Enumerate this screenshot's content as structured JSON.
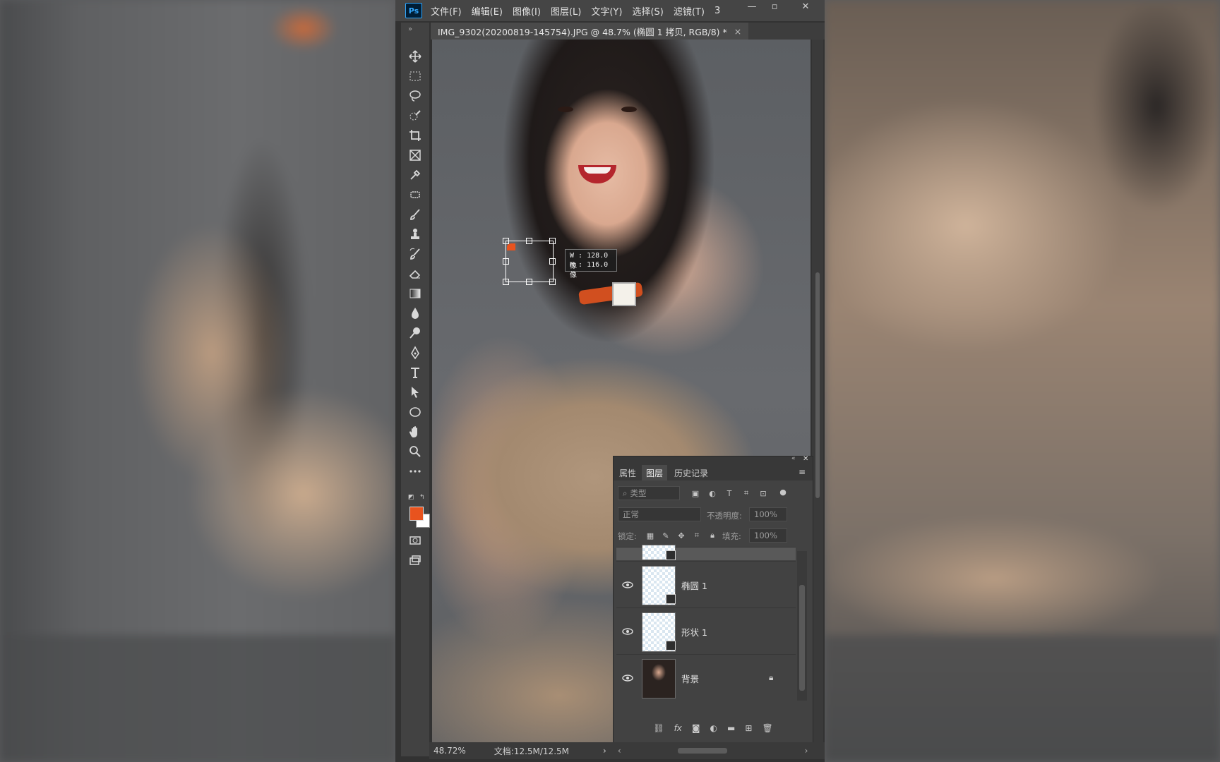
{
  "app": {
    "logo": "Ps"
  },
  "menu": [
    "文件(F)",
    "编辑(E)",
    "图像(I)",
    "图层(L)",
    "文字(Y)",
    "选择(S)",
    "滤镜(T)",
    "3"
  ],
  "window_controls": {
    "minimize": "—",
    "restore": "▫",
    "close": "✕"
  },
  "document_tab": {
    "title": "IMG_9302(20200819-145754).JPG @ 48.7% (椭圆 1 拷贝, RGB/8) *",
    "close": "×"
  },
  "tools": [
    "move-tool",
    "marquee-tool",
    "lasso-tool",
    "quick-select-tool",
    "crop-tool",
    "frame-tool",
    "eyedropper-tool",
    "healing-brush-tool",
    "brush-tool",
    "clone-stamp-tool",
    "history-brush-tool",
    "eraser-tool",
    "gradient-tool",
    "blur-tool",
    "dodge-tool",
    "pen-tool",
    "type-tool",
    "path-selection-tool",
    "ellipse-tool",
    "hand-tool",
    "zoom-tool",
    "edit-toolbar"
  ],
  "colors": {
    "foreground": "#e8531e",
    "background": "#ffffff"
  },
  "transform_readout": {
    "w": "W : 128.0 像",
    "h": "H : 116.0 像"
  },
  "status": {
    "zoom": "48.72%",
    "doc": "文档:12.5M/12.5M",
    "arrow": "›"
  },
  "layers_panel": {
    "tabs": [
      "属性",
      "图层",
      "历史记录"
    ],
    "active_tab": "图层",
    "filter_placeholder": "类型",
    "blend_mode": "正常",
    "opacity_label": "不透明度:",
    "opacity_value": "100%",
    "lock_label": "锁定:",
    "fill_label": "填充:",
    "fill_value": "100%",
    "layers": [
      {
        "name": "椭圆 1",
        "visible": true,
        "type": "shape"
      },
      {
        "name": "形状 1",
        "visible": true,
        "type": "shape"
      },
      {
        "name": "背景",
        "visible": true,
        "type": "photo",
        "locked": true
      }
    ],
    "footer_icons": [
      "link-icon",
      "fx-icon",
      "mask-icon",
      "adjustment-icon",
      "folder-icon",
      "new-layer-icon",
      "trash-icon"
    ],
    "fx_label": "fx"
  }
}
